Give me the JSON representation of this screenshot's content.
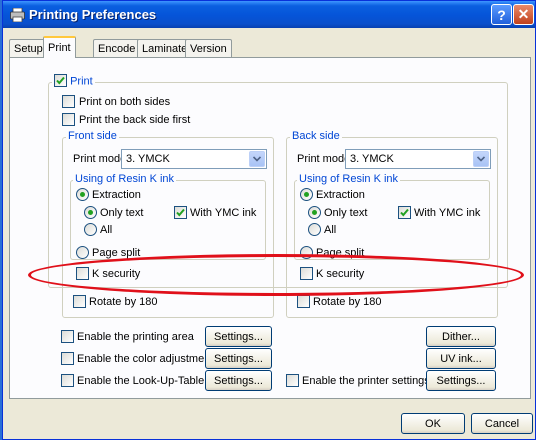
{
  "window": {
    "title": "Printing Preferences",
    "help_glyph": "?",
    "close_glyph": "✕",
    "icon": "printer-icon"
  },
  "tabs": [
    {
      "label": "Setup"
    },
    {
      "label": "Print",
      "active": true
    },
    {
      "label": "Encode"
    },
    {
      "label": "Laminate"
    },
    {
      "label": "Version"
    }
  ],
  "print": {
    "group_label": "Print",
    "checked": true,
    "both_sides": {
      "label": "Print on both sides",
      "checked": false
    },
    "back_first": {
      "label": "Print the back side first",
      "checked": false
    }
  },
  "front": {
    "title": "Front side",
    "mode_label": "Print mode:",
    "mode_value": "3. YMCK",
    "resin_title": "Using of Resin K ink",
    "extraction": {
      "label": "Extraction",
      "selected": true
    },
    "only_text": {
      "label": "Only text",
      "selected": true
    },
    "with_ymc": {
      "label": "With YMC ink",
      "checked": true
    },
    "all": {
      "label": "All",
      "selected": false
    },
    "page_split": {
      "label": "Page split",
      "selected": false
    },
    "k_security": {
      "label": "K security",
      "checked": false
    },
    "rotate": {
      "label": "Rotate by 180",
      "checked": false
    }
  },
  "back": {
    "title": "Back side",
    "mode_label": "Print mode:",
    "mode_value": "3. YMCK",
    "resin_title": "Using of Resin K ink",
    "extraction": {
      "label": "Extraction",
      "selected": true
    },
    "only_text": {
      "label": "Only text",
      "selected": true
    },
    "with_ymc": {
      "label": "With YMC ink",
      "checked": true
    },
    "all": {
      "label": "All",
      "selected": false
    },
    "page_split": {
      "label": "Page split",
      "selected": false
    },
    "k_security": {
      "label": "K security",
      "checked": false
    },
    "rotate": {
      "label": "Rotate by 180",
      "checked": false
    }
  },
  "options": {
    "printing_area": {
      "label": "Enable the printing area",
      "checked": false,
      "button": "Settings..."
    },
    "color_adjustment": {
      "label": "Enable the color adjustment",
      "checked": false,
      "button": "Settings..."
    },
    "lut": {
      "label": "Enable the Look-Up-Table",
      "checked": false,
      "button": "Settings..."
    },
    "printer_settings": {
      "label": "Enable the printer settings",
      "checked": false,
      "button": "Settings..."
    },
    "dither_button": "Dither...",
    "uv_button": "UV ink..."
  },
  "footer": {
    "ok": "OK",
    "cancel": "Cancel"
  },
  "annotation": {
    "color": "#e0101a",
    "shape": "red-ellipse"
  }
}
